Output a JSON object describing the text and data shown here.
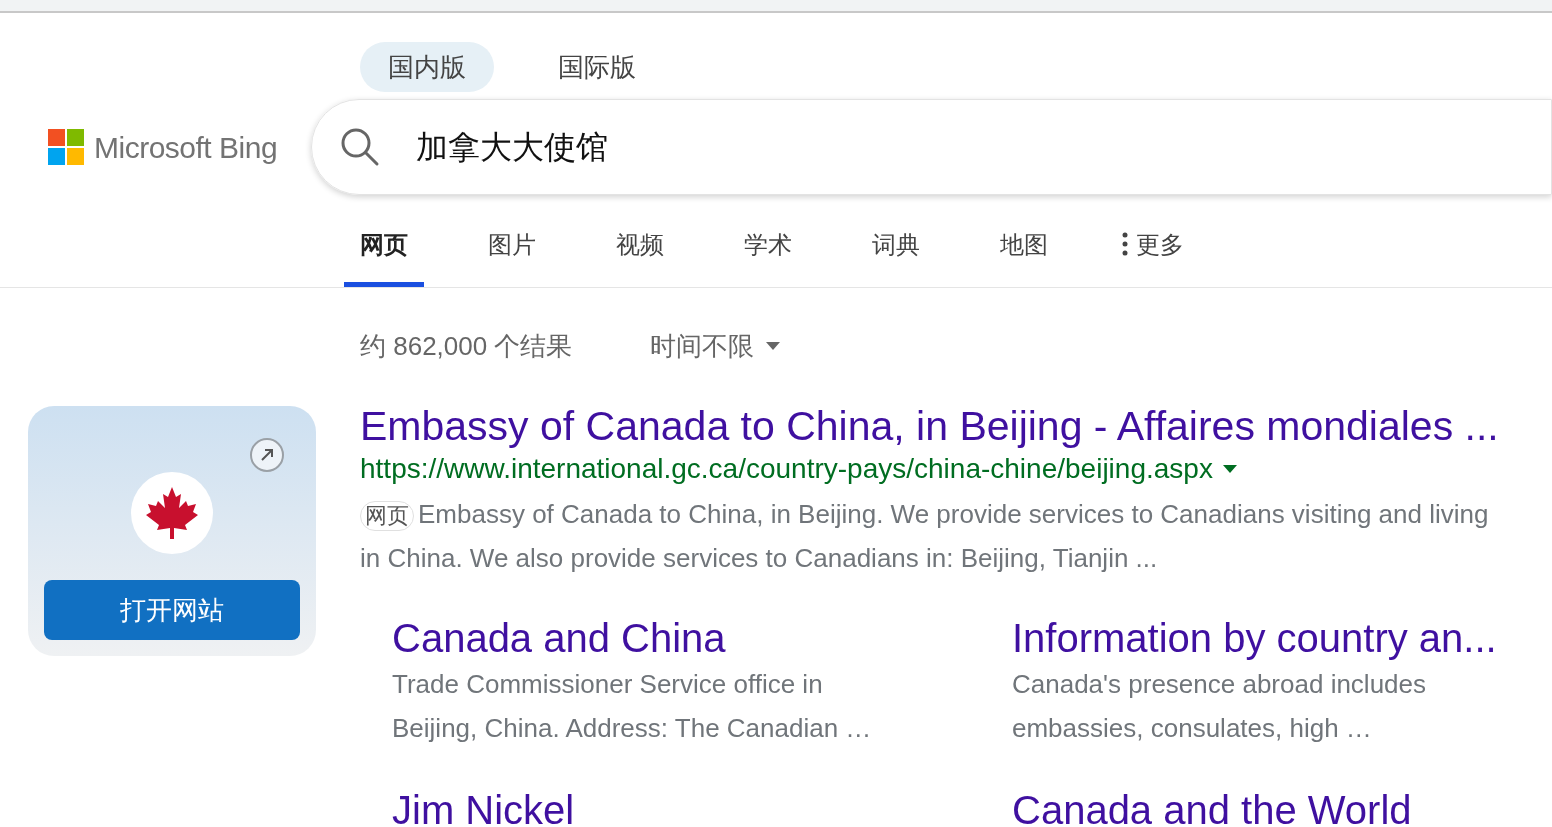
{
  "edition_tabs": [
    {
      "label": "国内版",
      "selected": true
    },
    {
      "label": "国际版",
      "selected": false
    }
  ],
  "logo": {
    "text": "Microsoft Bing"
  },
  "search": {
    "value": "加拿大大使馆"
  },
  "nav_tabs": [
    {
      "label": "网页",
      "selected": true
    },
    {
      "label": "图片",
      "selected": false
    },
    {
      "label": "视频",
      "selected": false
    },
    {
      "label": "学术",
      "selected": false
    },
    {
      "label": "词典",
      "selected": false
    },
    {
      "label": "地图",
      "selected": false
    }
  ],
  "more_menu": {
    "label": "更多"
  },
  "results_bar": {
    "count": "约 862,000 个结果",
    "time_filter": "时间不限"
  },
  "site_card": {
    "button": "打开网站"
  },
  "result": {
    "title": "Embassy of Canada to China, in Beijing - Affaires mondiales ...",
    "url": "https://www.international.gc.ca/country-pays/china-chine/beijing.aspx",
    "snippet_tag": "网页",
    "snippet": "Embassy of Canada to China, in Beijing. We provide services to Canadians visiting and living in China. We also provide services to Canadians in: Beijing, Tianjin ...",
    "deep_links": [
      {
        "title": "Canada and China",
        "snippet": "Trade Commissioner Service office in Beijing, China. Address: The Canadian …"
      },
      {
        "title": "Information by country an...",
        "snippet": "Canada's presence abroad includes embassies, consulates, high …"
      },
      {
        "title": "Jim Nickel"
      },
      {
        "title": "Canada and the World"
      }
    ]
  }
}
